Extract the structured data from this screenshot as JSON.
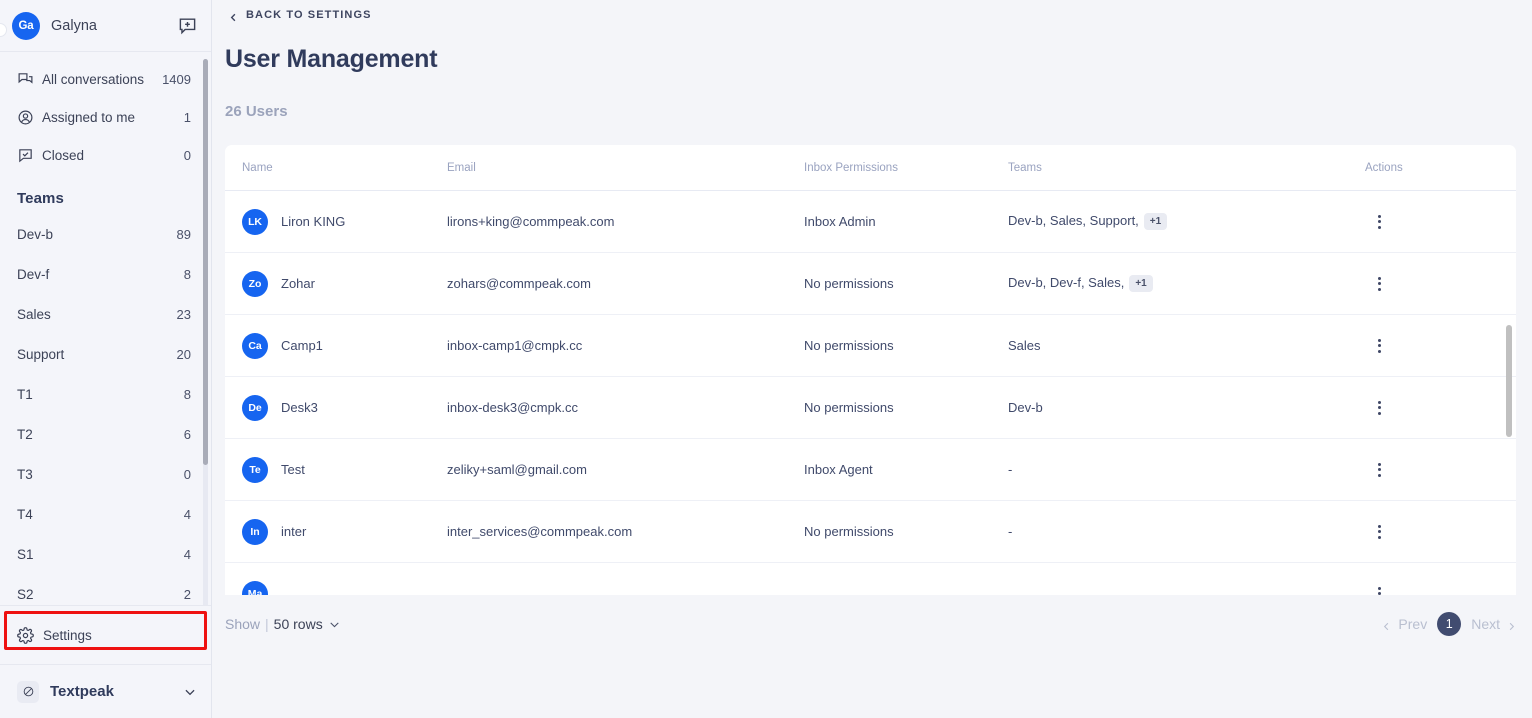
{
  "sidebar": {
    "brand": {
      "initials": "Ga",
      "name": "Galyna",
      "compose_icon": "compose-icon"
    },
    "nav": [
      {
        "icon": "conversations-icon",
        "label": "All conversations",
        "count": "1409"
      },
      {
        "icon": "assigned-icon",
        "label": "Assigned to me",
        "count": "1"
      },
      {
        "icon": "closed-icon",
        "label": "Closed",
        "count": "0"
      }
    ],
    "teams_title": "Teams",
    "teams": [
      {
        "label": "Dev-b",
        "count": "89"
      },
      {
        "label": "Dev-f",
        "count": "8"
      },
      {
        "label": "Sales",
        "count": "23"
      },
      {
        "label": "Support",
        "count": "20"
      },
      {
        "label": "T1",
        "count": "8"
      },
      {
        "label": "T2",
        "count": "6"
      },
      {
        "label": "T3",
        "count": "0"
      },
      {
        "label": "T4",
        "count": "4"
      },
      {
        "label": "S1",
        "count": "4"
      },
      {
        "label": "S2",
        "count": "2"
      }
    ],
    "settings": {
      "icon": "gear-icon",
      "label": "Settings",
      "highlighted": true
    },
    "footer": {
      "icon": "textpeak-icon",
      "label": "Textpeak",
      "chevron": "chevron-down-icon"
    }
  },
  "main": {
    "back_link": {
      "icon": "chevron-left-icon",
      "label": "BACK TO SETTINGS"
    },
    "title": "User Management",
    "subtitle": "26 Users",
    "table": {
      "columns": [
        "Name",
        "Email",
        "Inbox Permissions",
        "Teams",
        "Actions"
      ],
      "rows": [
        {
          "initials": "LK",
          "name": "Liron KING",
          "email": "lirons+king@commpeak.com",
          "permissions": "Inbox Admin",
          "teams": "Dev-b, Sales, Support,",
          "teams_more": "+1"
        },
        {
          "initials": "Zo",
          "name": "Zohar",
          "email": "zohars@commpeak.com",
          "permissions": "No permissions",
          "teams": "Dev-b, Dev-f, Sales,",
          "teams_more": "+1"
        },
        {
          "initials": "Ca",
          "name": "Camp1",
          "email": "inbox-camp1@cmpk.cc",
          "permissions": "No permissions",
          "teams": "Sales",
          "teams_more": ""
        },
        {
          "initials": "De",
          "name": "Desk3",
          "email": "inbox-desk3@cmpk.cc",
          "permissions": "No permissions",
          "teams": "Dev-b",
          "teams_more": ""
        },
        {
          "initials": "Te",
          "name": "Test",
          "email": "zeliky+saml@gmail.com",
          "permissions": "Inbox Agent",
          "teams": "-",
          "teams_more": ""
        },
        {
          "initials": "In",
          "name": "inter",
          "email": "inter_services@commpeak.com",
          "permissions": "No permissions",
          "teams": "-",
          "teams_more": ""
        },
        {
          "initials": "Ma",
          "name": "",
          "email": "",
          "permissions": "",
          "teams": "",
          "teams_more": ""
        }
      ]
    },
    "pagination": {
      "show_label": "Show",
      "separator": "|",
      "rows_value": "50 rows",
      "rows_chevron": "chevron-down-icon",
      "prev_label": "Prev",
      "current_page": "1",
      "next_label": "Next"
    }
  },
  "colors": {
    "accent_blue": "#1665f0",
    "highlight_red": "#ee1111",
    "page_bg": "#f4f5f9",
    "sidebar_bg": "#f4f5fa",
    "text_dark": "#303b5c",
    "text_muted": "#9ba3bb"
  }
}
